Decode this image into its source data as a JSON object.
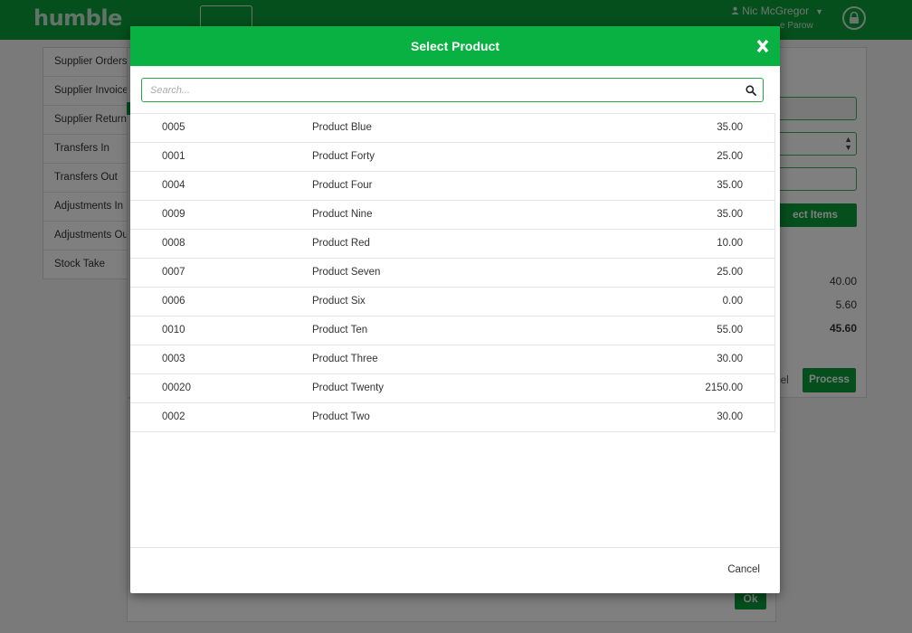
{
  "app": {
    "logo": "humble",
    "user_name": "Nic McGregor",
    "user_location": "e Parow",
    "accent": "#0a9e3a"
  },
  "sidebar": {
    "items": [
      {
        "label": "Supplier Orders"
      },
      {
        "label": "Supplier Invoices"
      },
      {
        "label": "Supplier Returns"
      },
      {
        "label": "Transfers In"
      },
      {
        "label": "Transfers Out"
      },
      {
        "label": "Adjustments In"
      },
      {
        "label": "Adjustments Out"
      },
      {
        "label": "Stock Take"
      }
    ]
  },
  "panel": {
    "select_items_label": "ect Items",
    "values": [
      "40.00",
      "5.60",
      "45.60"
    ],
    "cancel_label": "cel",
    "process_label": "Process",
    "ok_label": "Ok"
  },
  "modal": {
    "title": "Select Product",
    "header_color": "#08b141",
    "search": {
      "placeholder": "Search...",
      "value": ""
    },
    "products": [
      {
        "code": "0005",
        "name": "Product Blue",
        "price": "35.00"
      },
      {
        "code": "0001",
        "name": "Product Forty",
        "price": "25.00"
      },
      {
        "code": "0004",
        "name": "Product Four",
        "price": "35.00"
      },
      {
        "code": "0009",
        "name": "Product Nine",
        "price": "35.00"
      },
      {
        "code": "0008",
        "name": "Product Red",
        "price": "10.00"
      },
      {
        "code": "0007",
        "name": "Product Seven",
        "price": "25.00"
      },
      {
        "code": "0006",
        "name": "Product Six",
        "price": "0.00"
      },
      {
        "code": "0010",
        "name": "Product Ten",
        "price": "55.00"
      },
      {
        "code": "0003",
        "name": "Product Three",
        "price": "30.00"
      },
      {
        "code": "00020",
        "name": "Product Twenty",
        "price": "2150.00"
      },
      {
        "code": "0002",
        "name": "Product Two",
        "price": "30.00"
      }
    ],
    "cancel_label": "Cancel"
  }
}
